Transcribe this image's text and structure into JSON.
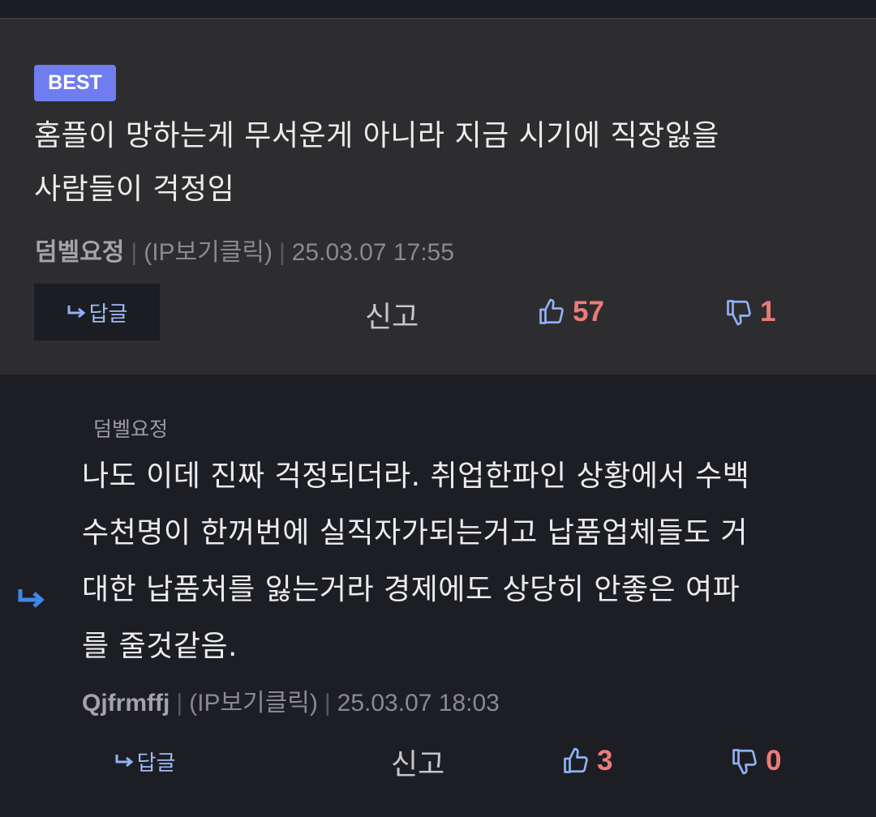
{
  "best": {
    "badge": "BEST",
    "text_line1": "홈플이 망하는게 무서운게 아니라 지금 시기에 직장잃을",
    "text_line2": "사람들이 걱정임",
    "author": "덤벨요정",
    "ip": "(IP보기클릭)",
    "timestamp": "25.03.07 17:55",
    "reply_label": "답글",
    "report_label": "신고",
    "likes": "57",
    "dislikes": "1"
  },
  "reply": {
    "reply_to": "덤벨요정",
    "text_line1": "나도 이데 진짜 걱정되더라. 취업한파인 상황에서 수백",
    "text_line2": "수천명이 한꺼번에 실직자가되는거고 납품업체들도 거",
    "text_line3": "대한 납품처를 잃는거라 경제에도 상당히 안좋은 여파",
    "text_line4": "를 줄것같음.",
    "author": "Qjfrmffj",
    "ip": "(IP보기클릭)",
    "timestamp": "25.03.07 18:03",
    "reply_label": "답글",
    "report_label": "신고",
    "likes": "3",
    "dislikes": "0"
  },
  "colors": {
    "badge": "#6f7df0",
    "vote_count": "#ef7a7a",
    "icon_blue": "#8fb1f5"
  }
}
